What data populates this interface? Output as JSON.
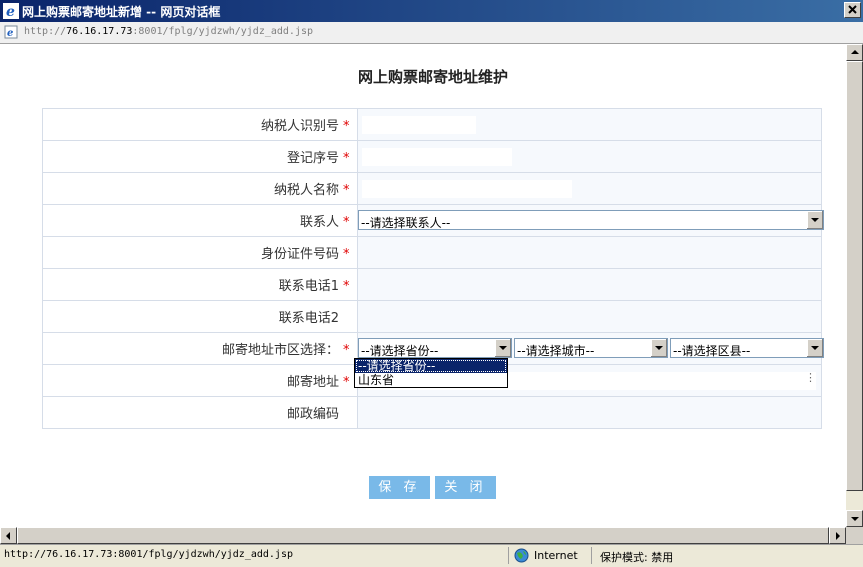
{
  "window": {
    "title": "网上购票邮寄地址新增 -- 网页对话框"
  },
  "address_bar": {
    "url_prefix": "http://",
    "url_host": "76.16.17.73",
    "url_rest": ":8001/fplg/yjdzwh/yjdz_add.jsp"
  },
  "page": {
    "title": "网上购票邮寄地址维护"
  },
  "form": {
    "required_mark": "*",
    "rows": [
      {
        "label": "纳税人识别号"
      },
      {
        "label": "登记序号"
      },
      {
        "label": "纳税人名称"
      },
      {
        "label": "联系人",
        "select_value": "--请选择联系人--"
      },
      {
        "label": "身份证件号码"
      },
      {
        "label": "联系电话1"
      },
      {
        "label": "联系电话2"
      },
      {
        "label": "邮寄地址市区选择：",
        "province": "--请选择省份--",
        "city": "--请选择城市--",
        "district": "--请选择区县--"
      },
      {
        "label": "邮寄地址"
      },
      {
        "label": "邮政编码"
      }
    ]
  },
  "province_dropdown": {
    "options": [
      "--请选择省份--",
      "山东省"
    ],
    "selected_index": 0
  },
  "buttons": {
    "save": "保 存",
    "close": "关 闭"
  },
  "status_bar": {
    "url": "http://76.16.17.73:8001/fplg/yjdzwh/yjdz_add.jsp",
    "zone": "Internet",
    "protected_mode": "保护模式: 禁用"
  },
  "colors": {
    "title_bar": "#0a246a",
    "button": "#79b9e8",
    "required": "#e00000",
    "value_cell": "#f6f9fd",
    "border": "#d6dde8"
  }
}
